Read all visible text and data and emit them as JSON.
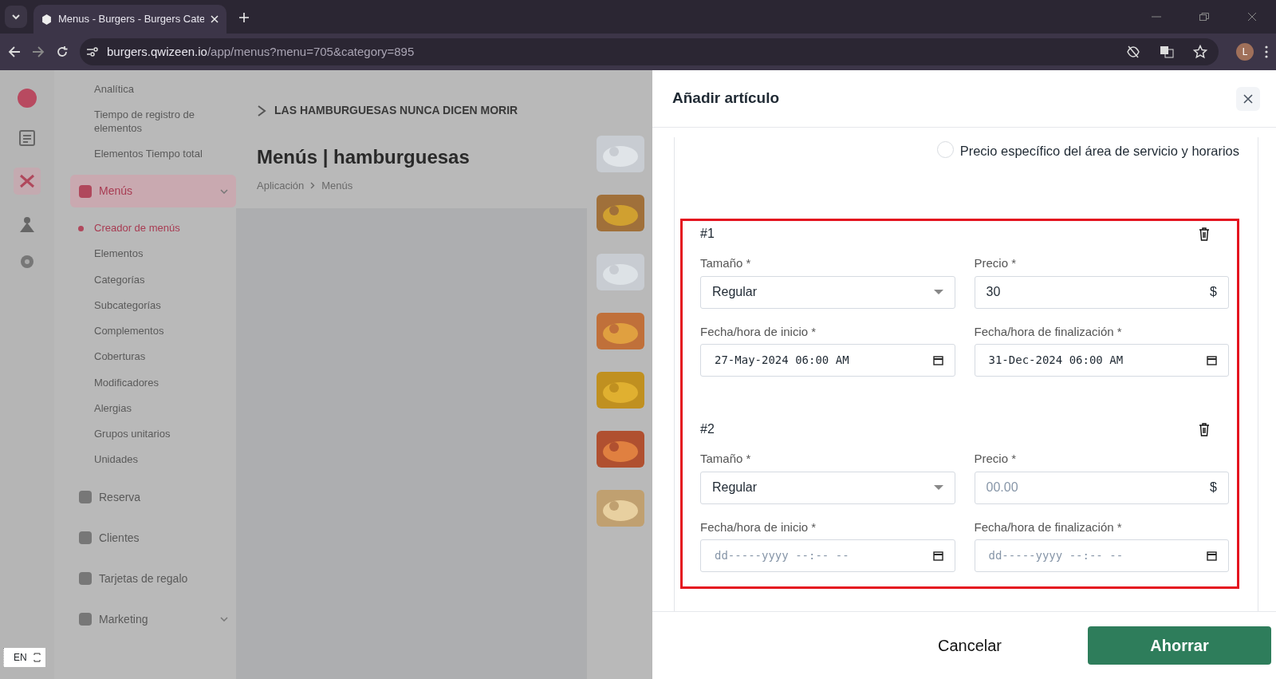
{
  "browser": {
    "tab_title": "Menus - Burgers - Burgers Cate",
    "url_host": "burgers.qwizeen.io",
    "url_path": "/app/menus?menu=705&category=895",
    "profile_initial": "L"
  },
  "background": {
    "sidebar_items": [
      {
        "kind": "subitem",
        "label": "Analítica",
        "selected": false
      },
      {
        "kind": "subitem",
        "label": "Tiempo de registro de elementos",
        "selected": false
      },
      {
        "kind": "subitem",
        "label": "Elementos Tiempo total",
        "selected": false
      },
      {
        "kind": "section",
        "label": "Menús",
        "selected": true
      },
      {
        "kind": "subitem",
        "label": "Creador de menús",
        "selected": true
      },
      {
        "kind": "subitem",
        "label": "Elementos",
        "selected": false
      },
      {
        "kind": "subitem",
        "label": "Categorías",
        "selected": false
      },
      {
        "kind": "subitem",
        "label": "Subcategorías",
        "selected": false
      },
      {
        "kind": "subitem",
        "label": "Complementos",
        "selected": false
      },
      {
        "kind": "subitem",
        "label": "Coberturas",
        "selected": false
      },
      {
        "kind": "subitem",
        "label": "Modificadores",
        "selected": false
      },
      {
        "kind": "subitem",
        "label": "Alergias",
        "selected": false
      },
      {
        "kind": "subitem",
        "label": "Grupos unitarios",
        "selected": false
      },
      {
        "kind": "subitem",
        "label": "Unidades",
        "selected": false
      },
      {
        "kind": "section",
        "label": "Reserva",
        "selected": false
      },
      {
        "kind": "section",
        "label": "Clientes",
        "selected": false
      },
      {
        "kind": "section",
        "label": "Tarjetas de regalo",
        "selected": false
      },
      {
        "kind": "section",
        "label": "Marketing",
        "selected": false
      }
    ],
    "restaurant_name": "LAS HAMBURGUESAS NUNCA DICEN MORIR",
    "page_title": "Menús | hamburguesas",
    "breadcrumb": [
      "Aplicación",
      "Menús"
    ]
  },
  "language_widget": {
    "label": "EN"
  },
  "drawer": {
    "title": "Añadir artículo",
    "price_option": {
      "label": "Precio específico del área de servicio y horarios",
      "selected": false
    },
    "entries": [
      {
        "number": "#1",
        "size_label": "Tamaño *",
        "size_value": "Regular",
        "price_label": "Precio *",
        "price_value": "30",
        "currency": "$",
        "start_label": "Fecha/hora de inicio *",
        "start_value": "27-May-2024 06:00 AM",
        "end_label": "Fecha/hora de finalización *",
        "end_value": "31-Dec-2024 06:00 AM"
      },
      {
        "number": "#2",
        "size_label": "Tamaño *",
        "size_value": "Regular",
        "price_label": "Precio *",
        "price_placeholder": "00.00",
        "currency": "$",
        "start_label": "Fecha/hora de inicio *",
        "start_placeholder": "dd-----yyyy --:-- --",
        "end_label": "Fecha/hora de finalización *",
        "end_placeholder": "dd-----yyyy --:-- --"
      }
    ],
    "cancel_button": "Cancelar",
    "save_button": "Ahorrar"
  }
}
